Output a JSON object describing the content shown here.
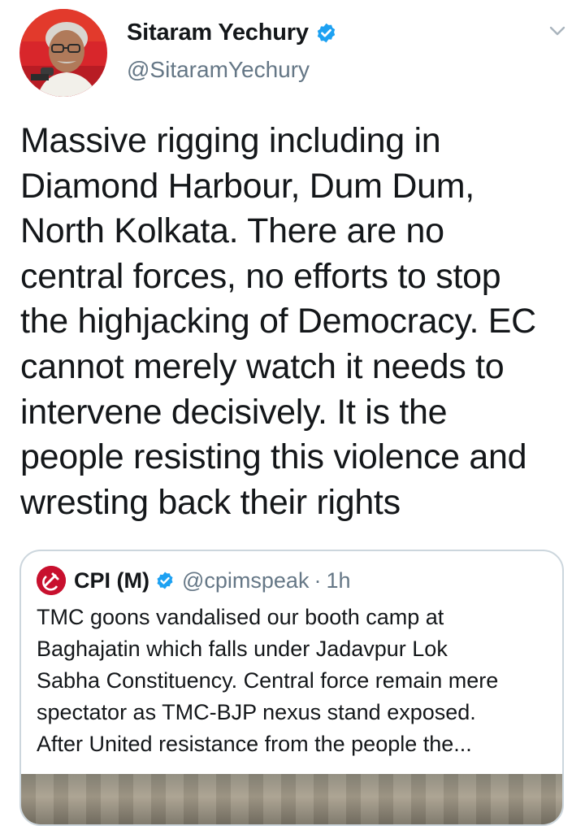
{
  "tweet": {
    "author": {
      "display_name": "Sitaram Yechury",
      "handle": "@SitaramYechury",
      "verified": true,
      "avatar_icon": "profile-photo-avatar"
    },
    "menu_icon": "chevron-down-icon",
    "text": "Massive rigging including in\nDiamond Harbour, Dum Dum,\nNorth Kolkata. There are no\ncentral forces, no efforts to stop\nthe highjacking of Democracy. EC\ncannot merely watch it needs to\nintervene decisively. It is the\npeople resisting this violence and\nwresting back their rights"
  },
  "quoted_tweet": {
    "display_name": "CPI (M)",
    "handle": "@cpimspeak",
    "separator": "·",
    "time": "1h",
    "verified": true,
    "logo_icon": "hammer-sickle-icon",
    "text": "TMC goons vandalised our booth camp at\nBaghajatin which falls under Jadavpur Lok\nSabha Constituency. Central force remain mere\nspectator as TMC-BJP nexus stand exposed.\nAfter United resistance from the people the..."
  },
  "colors": {
    "text_primary": "#14171a",
    "text_secondary": "#657786",
    "verified_blue": "#1da1f2",
    "border": "#ccd6dd",
    "cpim_red": "#c8102e"
  }
}
